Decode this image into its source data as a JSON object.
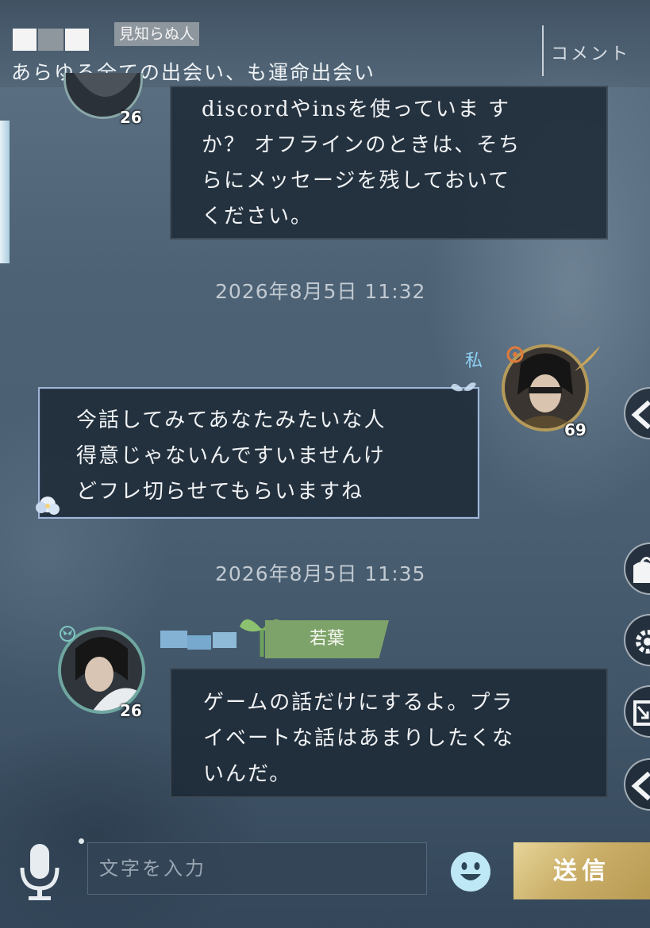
{
  "header": {
    "name_tag": "見知らぬ人",
    "title": "あらゆる全ての出会い、も運命出会い",
    "comment_button": "コメント"
  },
  "messages": [
    {
      "side": "theirs",
      "level": "26",
      "lines": [
        "discordやinsを使っていますか？オフラインのときは、そちらにメッセージを残しておいてください。"
      ],
      "display_lines": [
        "discordやinsを使っていま す",
        "か？ オフラインのときは、そち",
        "らにメッセージを残しておいて",
        "ください。"
      ]
    },
    {
      "side": "mine",
      "timestamp": "2026年8月5日 11:32",
      "sender_label": "私",
      "level": "69",
      "display_lines": [
        "今話してみてあなたみたいな人",
        "得意じゃないんですいませんけ",
        "どフレ切らせてもらいますね"
      ]
    },
    {
      "side": "theirs",
      "timestamp": "2026年8月5日 11:35",
      "badge": "若葉",
      "level": "26",
      "display_lines": [
        "ゲームの話だけにするよ。プラ",
        "イベートな話はあまりしたくな",
        "いんだ。"
      ]
    }
  ],
  "input": {
    "placeholder": "文字を入力",
    "send_label": "送信"
  },
  "colors": {
    "accent_gold": "#cbb06a",
    "my_bubble_border": "#9fb6d6",
    "badge_green": "#7ea36a",
    "me_label": "#8ed0f2"
  },
  "icons": [
    "microphone-icon",
    "smiley-icon",
    "chevron-left-icon",
    "bag-icon",
    "gear-icon",
    "share-icon"
  ]
}
